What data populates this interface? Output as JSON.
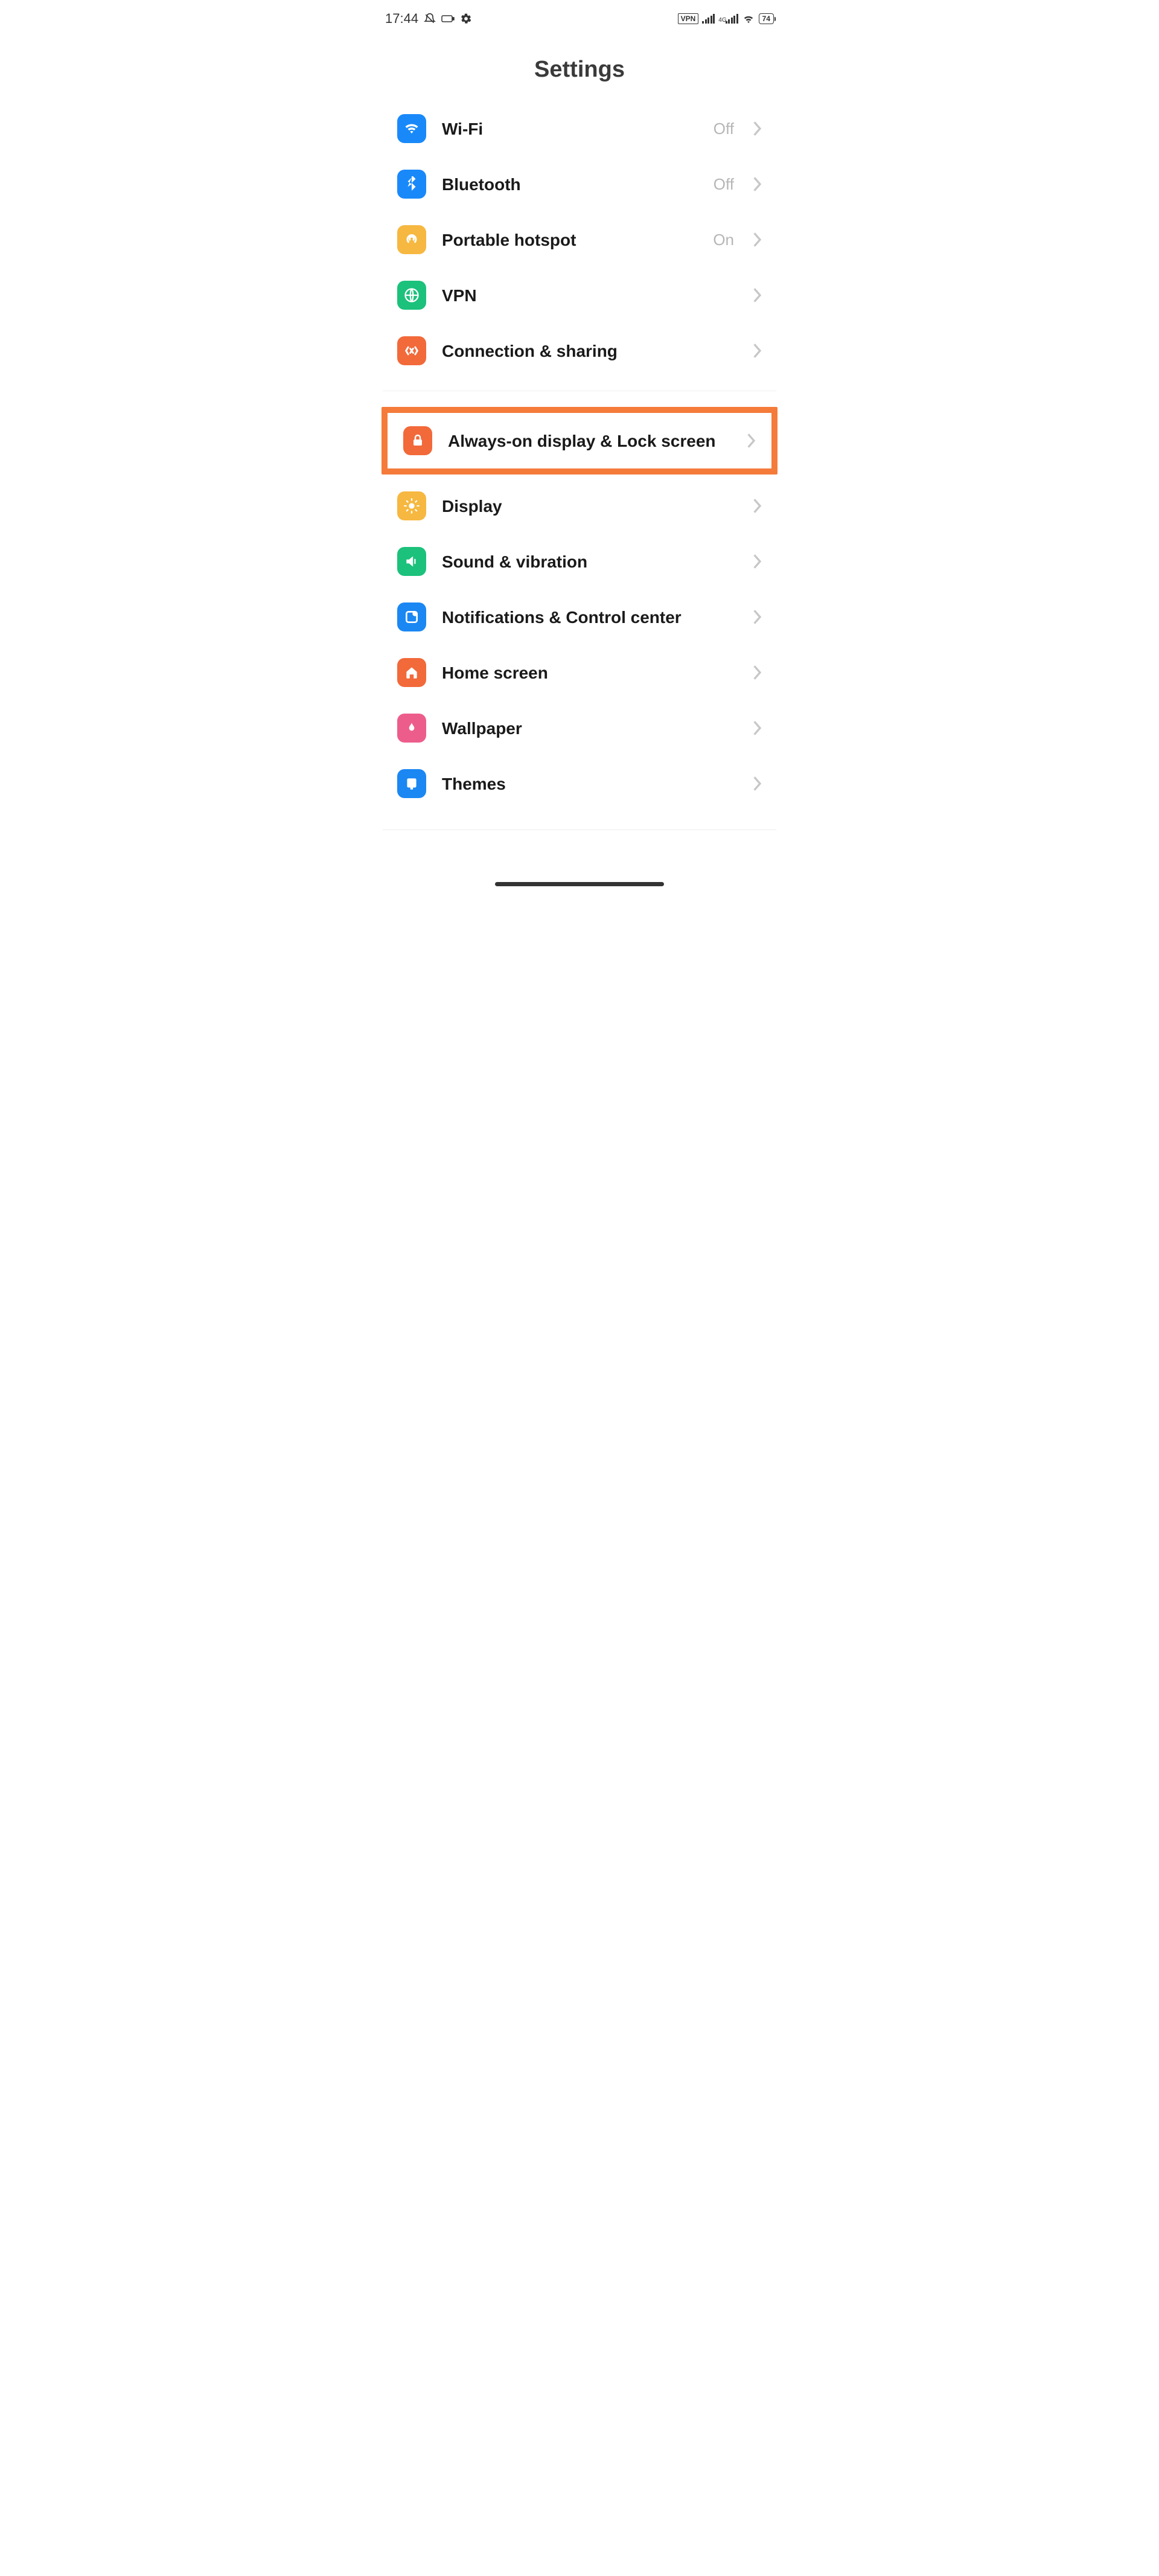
{
  "status": {
    "time": "17:44",
    "vpn_label": "VPN",
    "net_label": "4G",
    "battery": "74"
  },
  "title": "Settings",
  "group1": [
    {
      "id": "wifi",
      "label": "Wi-Fi",
      "value": "Off"
    },
    {
      "id": "bluetooth",
      "label": "Bluetooth",
      "value": "Off"
    },
    {
      "id": "hotspot",
      "label": "Portable hotspot",
      "value": "On"
    },
    {
      "id": "vpn",
      "label": "VPN",
      "value": ""
    },
    {
      "id": "connection",
      "label": "Connection & sharing",
      "value": ""
    }
  ],
  "highlighted": {
    "id": "aod",
    "label": "Always-on display & Lock screen"
  },
  "group2": [
    {
      "id": "display",
      "label": "Display"
    },
    {
      "id": "sound",
      "label": "Sound & vibration"
    },
    {
      "id": "notifications",
      "label": "Notifications & Control center"
    },
    {
      "id": "home",
      "label": "Home screen"
    },
    {
      "id": "wallpaper",
      "label": "Wallpaper"
    },
    {
      "id": "themes",
      "label": "Themes"
    }
  ]
}
